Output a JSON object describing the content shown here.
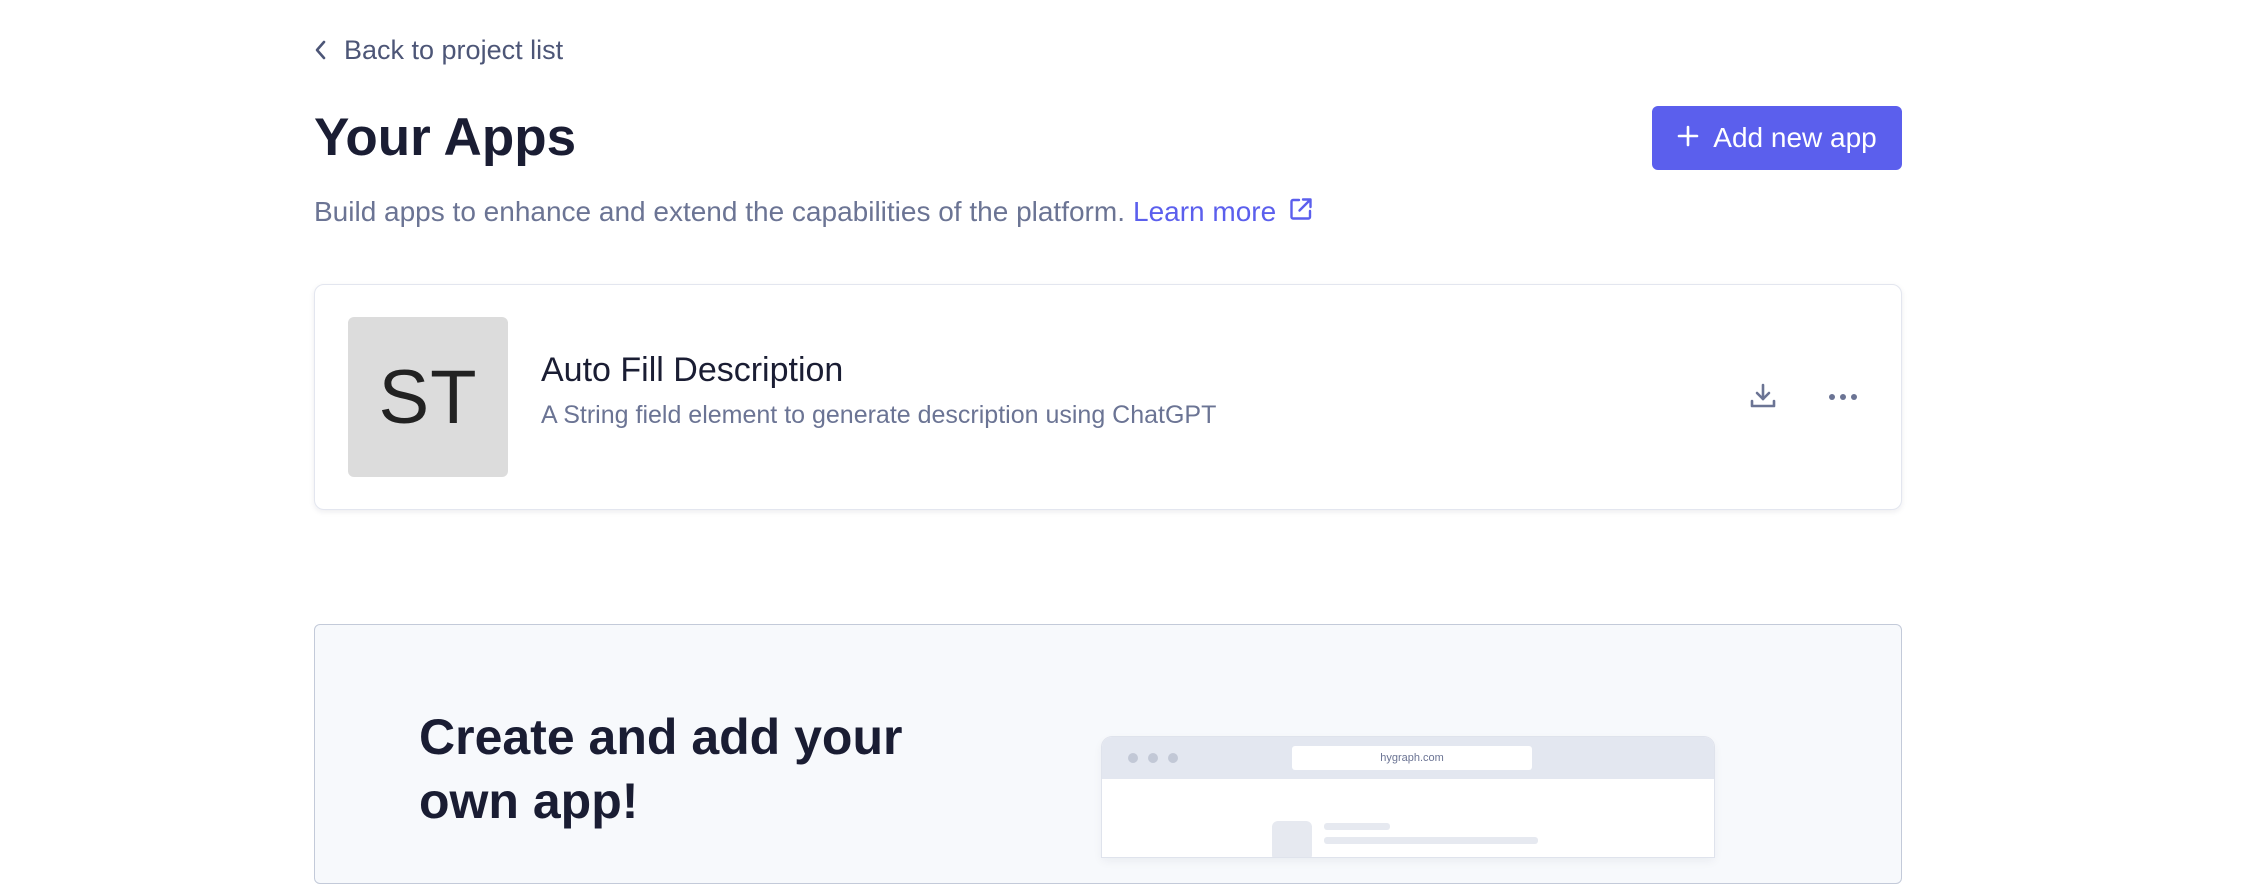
{
  "nav": {
    "back_label": "Back to project list"
  },
  "header": {
    "title": "Your Apps",
    "add_button_label": "Add new app",
    "subtitle": "Build apps to enhance and extend the capabilities of the platform.",
    "learn_more_label": "Learn more"
  },
  "apps": [
    {
      "avatar_text": "ST",
      "name": "Auto Fill Description",
      "description": "A String field element to generate description using ChatGPT"
    }
  ],
  "promo": {
    "title": "Create and add your own app!",
    "browser_url": "hygraph.com"
  },
  "colors": {
    "accent": "#5b5fed",
    "text_primary": "#1a1d33",
    "text_secondary": "#6b7494",
    "promo_background": "#f7f9fc"
  },
  "icons": {
    "back": "chevron-left-icon",
    "add": "plus-icon",
    "learn_more": "external-link-icon",
    "install": "download-icon",
    "menu": "more-horizontal-icon"
  }
}
